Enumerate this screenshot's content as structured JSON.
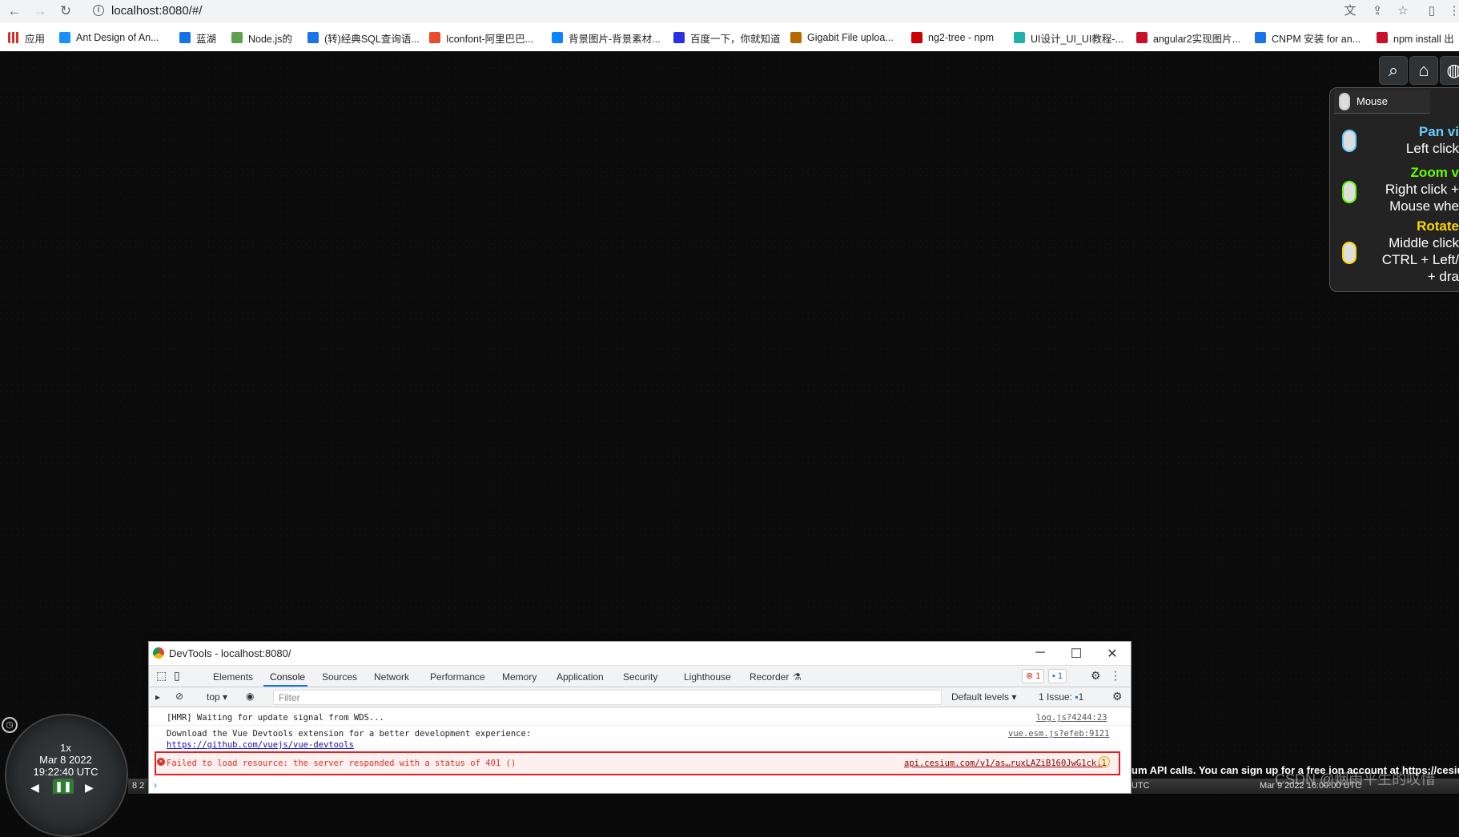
{
  "browser": {
    "url": "localhost:8080/#/",
    "nav": {
      "back": "←",
      "forward": "→",
      "reload": "↻"
    },
    "right_icons": [
      "translate-icon",
      "share-icon",
      "star-icon",
      "sidepanel-icon",
      "menu-icon"
    ],
    "bookmarks": [
      {
        "label": "应用",
        "color": "#d93025"
      },
      {
        "label": "Ant Design of An...",
        "color": "#1890ff"
      },
      {
        "label": "蓝湖",
        "color": "#1473e6"
      },
      {
        "label": "Node.js的",
        "color": "#5fa04e"
      },
      {
        "label": "(转)经典SQL查询语...",
        "color": "#1a73e8"
      },
      {
        "label": "Iconfont-阿里巴巴...",
        "color": "#e94b2f"
      },
      {
        "label": "背景图片-背景素材...",
        "color": "#0a84ff"
      },
      {
        "label": "百度一下，你就知道",
        "color": "#2932e1"
      },
      {
        "label": "Gigabit File uploa...",
        "color": "#b36b00"
      },
      {
        "label": "ng2-tree - npm",
        "color": "#cb0000"
      },
      {
        "label": "UI设计_UI_UI教程-...",
        "color": "#20b2aa"
      },
      {
        "label": "angular2实现图片...",
        "color": "#c8102e"
      },
      {
        "label": "CNPM 安装 for an...",
        "color": "#1a73e8"
      },
      {
        "label": "npm install 出",
        "color": "#c8102e"
      }
    ]
  },
  "cesium": {
    "toolbar": [
      "search-icon",
      "home-icon",
      "globe-icon"
    ],
    "help": {
      "tab": "Mouse",
      "pan": {
        "title": "Pan vi",
        "lines": [
          "Left click"
        ]
      },
      "zoom": {
        "title": "Zoom v",
        "lines": [
          "Right click +",
          "Mouse whe"
        ]
      },
      "rotate": {
        "title": "Rotate",
        "lines": [
          "Middle click",
          "CTRL + Left/",
          "+ dra"
        ]
      },
      "colors": {
        "pan": "#66ccff",
        "zoom": "#65fd00",
        "rotate": "#ffd700"
      }
    },
    "animation": {
      "speed": "1x",
      "date": "Mar 8 2022",
      "time": "19:22:40 UTC"
    },
    "credit": "um API calls. You can sign up for a free ion account at https://cesium",
    "timeline_left": "8 2",
    "timeline_utc": "UTC",
    "timeline_date": "Mar 9 2022 16:00:00 UTC",
    "watermark": "CSDN @烟雨平生的叹惜"
  },
  "devtools": {
    "title": "DevTools - localhost:8080/",
    "tabs": [
      "Elements",
      "Console",
      "Sources",
      "Network",
      "Performance",
      "Memory",
      "Application",
      "Security",
      "Lighthouse",
      "Recorder"
    ],
    "error_count": "1",
    "message_count": "1",
    "context": "top",
    "filter_placeholder": "Filter",
    "levels": "Default levels",
    "issues": "1 Issue:",
    "issues_count": "1",
    "logs": [
      {
        "text": "[HMR] Waiting for update signal from WDS...",
        "src": "log.js?4244:23"
      },
      {
        "text": "Download the Vue Devtools extension for a better development experience:",
        "src": "vue.esm.js?efeb:9121",
        "link": "https://github.com/vuejs/vue-devtools"
      }
    ],
    "error": {
      "text": "Failed to load resource: the server responded with a status of 401 ()",
      "src": "api.cesium.com/v1/as…ruxLAZiB160JwG1ck:1"
    }
  }
}
